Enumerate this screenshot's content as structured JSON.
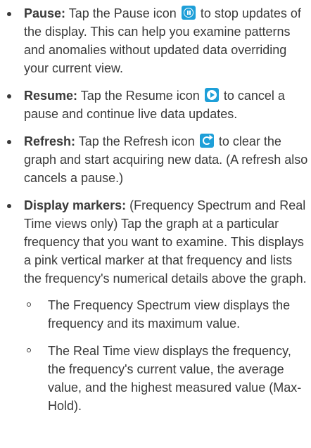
{
  "items": [
    {
      "term": "Pause:",
      "before": " Tap the Pause icon ",
      "icon": "pause-icon",
      "after": " to stop updates of the display. This can help you examine patterns and anomalies without updated data overriding your current view."
    },
    {
      "term": "Resume:",
      "before": " Tap the Resume icon ",
      "icon": "resume-icon",
      "after": " to cancel a pause and continue live data updates."
    },
    {
      "term": "Refresh:",
      "before": " Tap the Refresh icon ",
      "icon": "refresh-icon",
      "after": " to clear the graph and start acquiring new data. (A refresh also cancels a pause.)"
    },
    {
      "term": "Display markers:",
      "text": " (Frequency Spectrum and Real Time views only) Tap the graph at a particular frequency that you want to examine. This displays a pink vertical marker at that frequency and lists the frequency's numerical details above the graph.",
      "subitems": [
        "The Frequency Spectrum view displays the frequency and its maximum value.",
        "The Real Time view displays the frequency, the frequency's current value, the average value, and the highest measured value (Max-Hold)."
      ]
    }
  ],
  "colors": {
    "icon_bg": "#1e9fd8",
    "text": "#3a3a3a"
  }
}
